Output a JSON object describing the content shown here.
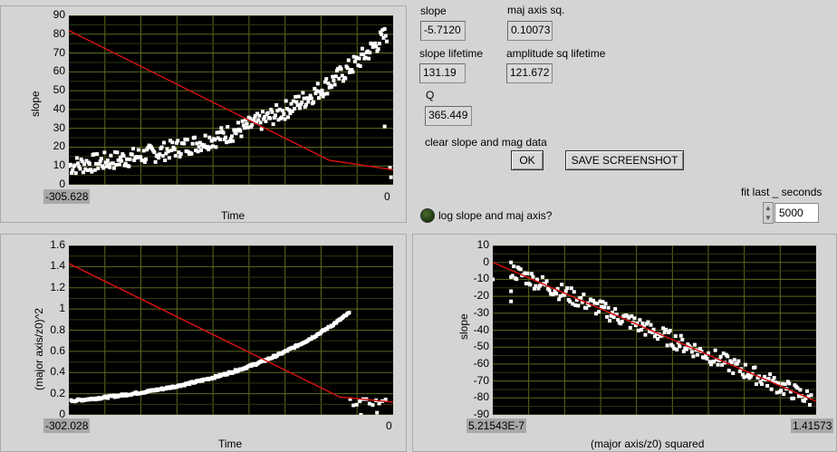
{
  "colors": {
    "plot_bg": "#000000",
    "grid": "#5a6b1e",
    "fit": "#d01010",
    "points": "#ffffff"
  },
  "indicators": {
    "slope": {
      "label": "slope",
      "value": "-5.7120"
    },
    "maj_axis_sq": {
      "label": "maj axis sq.",
      "value": "0.10073"
    },
    "slope_lifetime": {
      "label": "slope lifetime",
      "value": "131.19"
    },
    "amplitude_sq_lifetime": {
      "label": "amplitude sq lifetime",
      "value": "121.672"
    },
    "q": {
      "label": "Q",
      "value": "365.449"
    }
  },
  "controls": {
    "clear_label": "clear slope and mag data",
    "ok_button": "OK",
    "save_button": "SAVE SCREENSHOT",
    "log_label": "log slope and maj axis?",
    "fit_label": "fit last _ seconds",
    "fit_value": "5000"
  },
  "chart_data": [
    {
      "type": "scatter",
      "title": "",
      "xlabel": "Time",
      "ylabel": "slope",
      "xlim": [
        -305.628,
        0
      ],
      "ylim": [
        0,
        90
      ],
      "x_tick_labels": [
        "-305.628",
        "0"
      ],
      "y_ticks": [
        0,
        10,
        20,
        30,
        40,
        50,
        60,
        70,
        80,
        90
      ],
      "grid": true,
      "points_formula": "y ≈ 82·exp(x/131.19) with scatter",
      "fit_line": {
        "x": [
          -305.628,
          -60,
          0
        ],
        "y": [
          82,
          13,
          8
        ]
      }
    },
    {
      "type": "scatter",
      "title": "",
      "xlabel": "Time",
      "ylabel": "(major axis/z0)^2",
      "xlim": [
        -302.028,
        0
      ],
      "ylim": [
        0,
        1.6
      ],
      "x_tick_labels": [
        "-302.028",
        "0"
      ],
      "y_ticks": [
        0,
        0.2,
        0.4,
        0.6,
        0.8,
        1,
        1.2,
        1.4,
        1.6
      ],
      "grid": true,
      "fit_line": {
        "x": [
          -302.028,
          -50,
          0
        ],
        "y": [
          1.43,
          0.17,
          0.12
        ]
      }
    },
    {
      "type": "scatter",
      "title": "",
      "xlabel": "(major axis/z0) squared",
      "ylabel": "slope",
      "xlim": [
        5.21543e-07,
        1.41573
      ],
      "ylim": [
        -90,
        10
      ],
      "x_tick_labels": [
        "5.21543E-7",
        "1.41573"
      ],
      "y_ticks": [
        10,
        0,
        -10,
        -20,
        -30,
        -40,
        -50,
        -60,
        -70,
        -80,
        -90
      ],
      "grid": true,
      "fit_line": {
        "x": [
          0,
          1.41573
        ],
        "y": [
          0,
          -82
        ]
      }
    }
  ]
}
